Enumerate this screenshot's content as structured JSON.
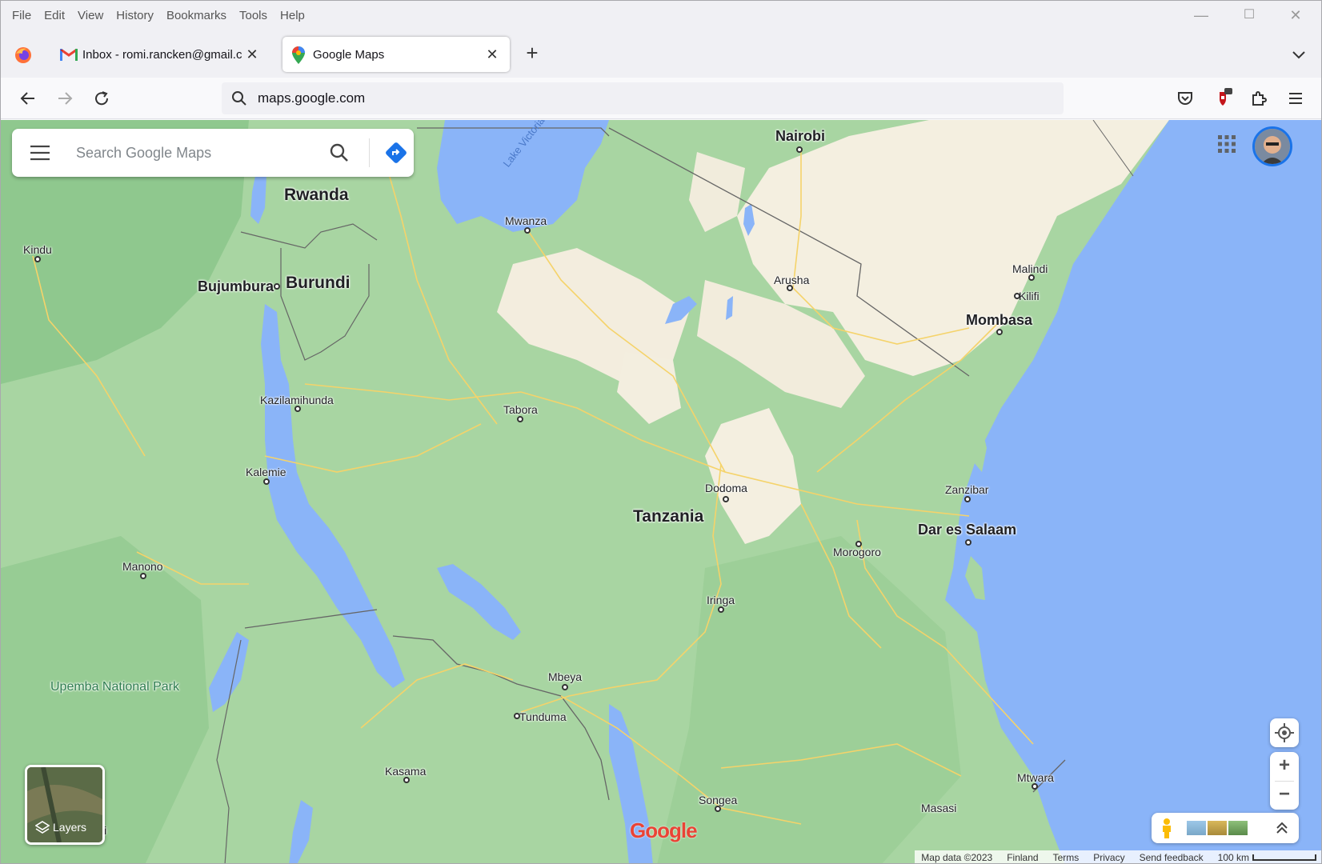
{
  "menubar": {
    "items": [
      "File",
      "Edit",
      "View",
      "History",
      "Bookmarks",
      "Tools",
      "Help"
    ]
  },
  "tabs": [
    {
      "title": "Inbox - romi.rancken@gmail.com",
      "icon": "gmail-icon",
      "active": false
    },
    {
      "title": "Google Maps",
      "icon": "google-maps-pin-icon",
      "active": true
    }
  ],
  "navbar": {
    "url": "maps.google.com"
  },
  "search": {
    "placeholder": "Search Google Maps"
  },
  "map": {
    "countries": [
      "Rwanda",
      "Burundi",
      "Tanzania"
    ],
    "major_cities": [
      "Nairobi",
      "Mombasa",
      "Dar es Salaam"
    ],
    "cities": [
      "Mwanza",
      "Kindu",
      "Bujumbura",
      "Arusha",
      "Malindi",
      "Kilifi",
      "Kazilamihunda",
      "Tabora",
      "Kalemie",
      "Dodoma",
      "Zanzibar",
      "Morogoro",
      "Manono",
      "Iringa",
      "Mbeya",
      "Tunduma",
      "Kasama",
      "Songea",
      "Masasi",
      "Mtwara"
    ],
    "park": "Upemba National Park",
    "lake_label": "Lake Victoria",
    "partial_label": "ii",
    "logo": "Google",
    "colors": {
      "water": "#8ab4f8",
      "land": "#a8d5a2",
      "highland": "#f5f0e1",
      "roads": "#f7d774"
    }
  },
  "controls": {
    "layers_label": "Layers",
    "zoom_in": "+",
    "zoom_out": "−"
  },
  "footer": {
    "map_data": "Map data ©2023",
    "region": "Finland",
    "terms": "Terms",
    "privacy": "Privacy",
    "feedback": "Send feedback",
    "scale": "100 km"
  }
}
